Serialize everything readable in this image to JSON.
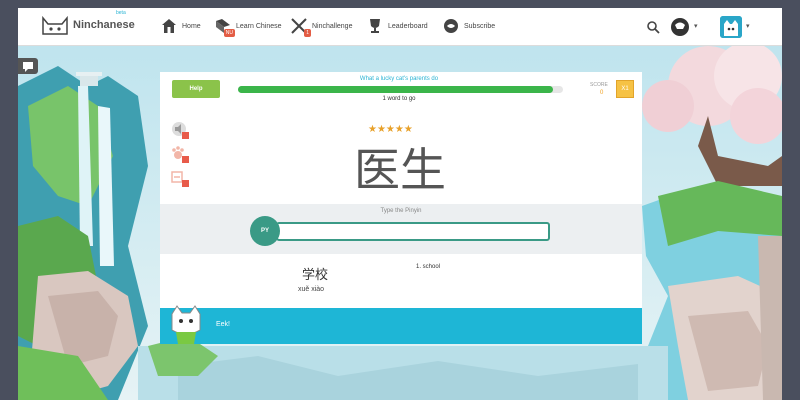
{
  "nav": {
    "brand": "Ninchanese",
    "brand_sup": "beta",
    "items": [
      {
        "label": "Home",
        "icon": "house-icon"
      },
      {
        "label": "Learn Chinese",
        "icon": "book-icon",
        "badge": "NU"
      },
      {
        "label": "Ninchallenge",
        "icon": "swords-icon",
        "badge": "1"
      },
      {
        "label": "Leaderboard",
        "icon": "trophy-icon"
      },
      {
        "label": "Subscribe",
        "icon": "star-badge-icon"
      }
    ],
    "caret": "▾"
  },
  "quiz": {
    "help_label": "Help",
    "progress_title": "What a lucky cat's parents do",
    "progress_value": 0.97,
    "progress_sub": "1 word to go",
    "score_label": "SCORE",
    "score_value": "0",
    "multiplier": "X1",
    "stars": "★★★★★",
    "hanzi": "医生",
    "input_label": "Type the Pinyin",
    "input_badge": "PY",
    "input_value": "",
    "answer_word": "学校",
    "answer_pinyin": "xuě xiào",
    "answer_definition": "1. school",
    "feedback": "Eek!"
  },
  "colors": {
    "accent": "#1eb6d6",
    "progress": "#3bb54a",
    "help": "#8bc34a",
    "input_border": "#3a9a86",
    "stars": "#e8a12a"
  }
}
